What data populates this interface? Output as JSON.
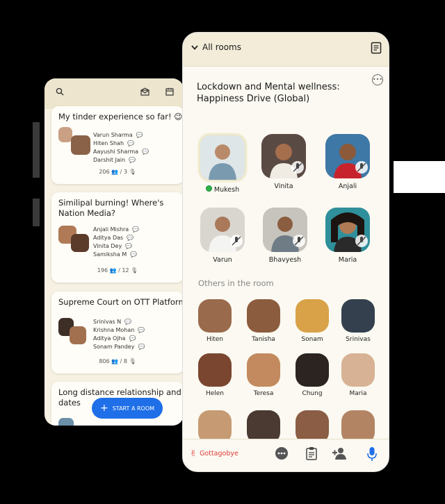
{
  "back_phone": {
    "cards": [
      {
        "title": "My tinder experience so far! 😉",
        "names": [
          "Varun Sharma",
          "Hiten Shah",
          "Aayushi Sharma",
          "Darshit Jain"
        ],
        "stats": "206  👥  /  3  🎙"
      },
      {
        "title": "Similipal burning! Where's Nation Media?",
        "names": [
          "Anjali Mishra",
          "Aditya Das",
          "Vinita Dey",
          "Samiksha M"
        ],
        "stats": "196  👥  /  12  🎙"
      },
      {
        "title": "Supreme Court on OTT Platforms",
        "names": [
          "Srinivas N",
          "Krishna Mohan",
          "Aditya Ojha",
          "Sonam Pandey"
        ],
        "stats": "806  👥  /  8  🎙"
      },
      {
        "title": "Long distance relationship and z dates",
        "names": [],
        "stats": ""
      }
    ],
    "start_room_label": "START A ROOM"
  },
  "front_phone": {
    "header_label": "All rooms",
    "room_title": "Lockdown and Mental wellness: Happiness Drive (Global)",
    "speakers": [
      {
        "name": "Mukesh",
        "active": true
      },
      {
        "name": "Vinita"
      },
      {
        "name": "Anjali"
      },
      {
        "name": "Varun"
      },
      {
        "name": "Bhavyesh"
      },
      {
        "name": "Maria"
      }
    ],
    "others_label": "Others in the room",
    "listeners": [
      "Hiten",
      "Tanisha",
      "Sonam",
      "Srinivas",
      "Helen",
      "Teresa",
      "Chung",
      "Maria",
      "",
      "",
      "",
      ""
    ],
    "bottom_bar": {
      "goodbye_label": "Gottagobye"
    }
  },
  "colors": {
    "accent": "#1f6fe8",
    "goodbye": "#e23b3b",
    "active_dot": "#2db24a"
  }
}
